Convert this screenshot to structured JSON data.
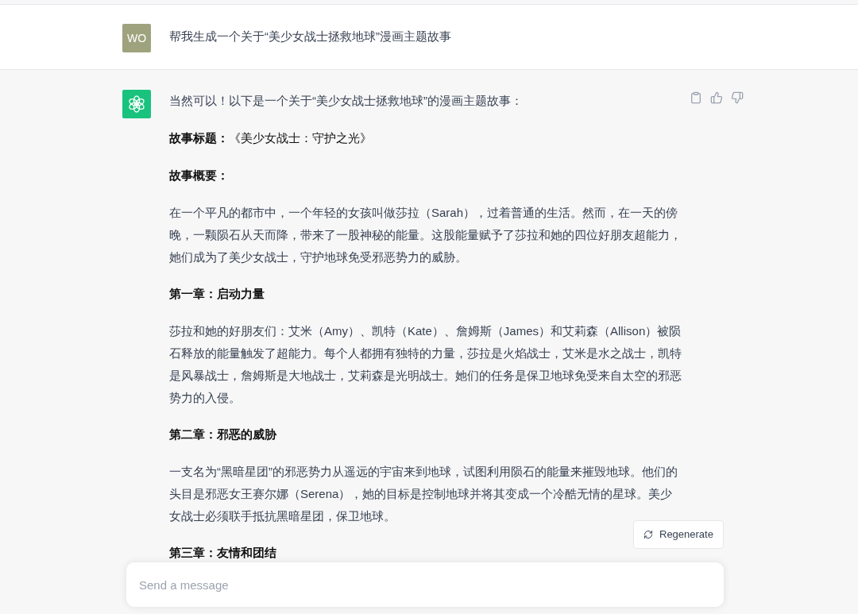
{
  "user_message": {
    "avatar_initials": "WO",
    "text": "帮我生成一个关于“美少女战士拯救地球”漫画主题故事"
  },
  "assistant_message": {
    "intro": "当然可以！以下是一个关于“美少女战士拯救地球”的漫画主题故事：",
    "blocks": [
      {
        "kind": "line",
        "text": "**故事标题：**《美少女战士：守护之光》"
      },
      {
        "kind": "heading",
        "text": "故事概要："
      },
      {
        "kind": "paragraph",
        "text": "在一个平凡的都市中，一个年轻的女孩叫做莎拉（Sarah），过着普通的生活。然而，在一天的傍晚，一颗陨石从天而降，带来了一股神秘的能量。这股能量赋予了莎拉和她的四位好朋友超能力，她们成为了美少女战士，守护地球免受邪恶势力的威胁。"
      },
      {
        "kind": "heading",
        "text": "第一章：启动力量"
      },
      {
        "kind": "paragraph",
        "text": "莎拉和她的好朋友们：艾米（Amy）、凯特（Kate）、詹姆斯（James）和艾莉森（Allison）被陨石释放的能量触发了超能力。每个人都拥有独特的力量，莎拉是火焰战士，艾米是水之战士，凯特是风暴战士，詹姆斯是大地战士，艾莉森是光明战士。她们的任务是保卫地球免受来自太空的邪恶势力的入侵。"
      },
      {
        "kind": "heading",
        "text": "第二章：邪恶的威胁"
      },
      {
        "kind": "paragraph",
        "text": "一支名为“黑暗星团”的邪恶势力从遥远的宇宙来到地球，试图利用陨石的能量来摧毁地球。他们的头目是邪恶女王赛尔娜（Serena），她的目标是控制地球并将其变成一个冷酷无情的星球。美少女战士必须联手抵抗黑暗星团，保卫地球。"
      },
      {
        "kind": "heading",
        "text": "第三章：友情和团结"
      }
    ]
  },
  "regenerate_button": "Regenerate",
  "message_input": {
    "placeholder": "Send a message"
  }
}
